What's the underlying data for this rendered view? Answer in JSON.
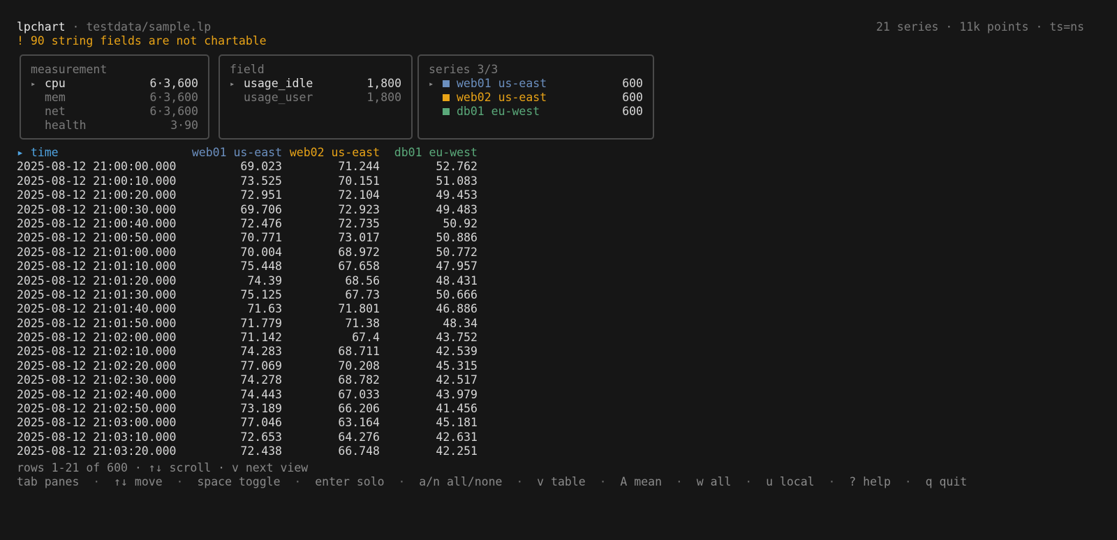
{
  "app": {
    "name": "lpchart",
    "separator": "·",
    "file": "testdata/sample.lp",
    "summary": "21 series · 11k points · ts=ns"
  },
  "warning": "! 90 string fields are not chartable",
  "colors": {
    "web01": "#6b8fbf",
    "web02": "#e8a317",
    "db01": "#5aa97a",
    "time_header": "#4fa3e0"
  },
  "panes": {
    "measurement": {
      "title": "measurement",
      "items": [
        {
          "label": "cpu",
          "count": "6·3,600",
          "active": true
        },
        {
          "label": "mem",
          "count": "6·3,600",
          "active": false
        },
        {
          "label": "net",
          "count": "6·3,600",
          "active": false
        },
        {
          "label": "health",
          "count": "3·90",
          "active": false
        }
      ]
    },
    "field": {
      "title": "field",
      "items": [
        {
          "label": "usage_idle",
          "count": "1,800",
          "active": true
        },
        {
          "label": "usage_user",
          "count": "1,800",
          "active": false
        }
      ]
    },
    "series": {
      "title": "series 3/3",
      "items": [
        {
          "label": "web01 us-east",
          "count": "600",
          "color": "#6b8fbf",
          "icon": "square-swatch"
        },
        {
          "label": "web02 us-east",
          "count": "600",
          "color": "#e8a317",
          "icon": "square-swatch"
        },
        {
          "label": "db01 eu-west",
          "count": "600",
          "color": "#5aa97a",
          "icon": "square-swatch"
        }
      ]
    }
  },
  "table": {
    "header": {
      "marker": "▸",
      "time": "time",
      "cols": [
        {
          "label": "web01 us-east",
          "color": "#6b8fbf"
        },
        {
          "label": "web02 us-east",
          "color": "#e8a317"
        },
        {
          "label": "db01 eu-west",
          "color": "#5aa97a"
        }
      ]
    },
    "rows": [
      [
        "2025-08-12 21:00:00.000",
        "69.023",
        "71.244",
        "52.762"
      ],
      [
        "2025-08-12 21:00:10.000",
        "73.525",
        "70.151",
        "51.083"
      ],
      [
        "2025-08-12 21:00:20.000",
        "72.951",
        "72.104",
        "49.453"
      ],
      [
        "2025-08-12 21:00:30.000",
        "69.706",
        "72.923",
        "49.483"
      ],
      [
        "2025-08-12 21:00:40.000",
        "72.476",
        "72.735",
        "50.92"
      ],
      [
        "2025-08-12 21:00:50.000",
        "70.771",
        "73.017",
        "50.886"
      ],
      [
        "2025-08-12 21:01:00.000",
        "70.004",
        "68.972",
        "50.772"
      ],
      [
        "2025-08-12 21:01:10.000",
        "75.448",
        "67.658",
        "47.957"
      ],
      [
        "2025-08-12 21:01:20.000",
        "74.39",
        "68.56",
        "48.431"
      ],
      [
        "2025-08-12 21:01:30.000",
        "75.125",
        "67.73",
        "50.666"
      ],
      [
        "2025-08-12 21:01:40.000",
        "71.63",
        "71.801",
        "46.886"
      ],
      [
        "2025-08-12 21:01:50.000",
        "71.779",
        "71.38",
        "48.34"
      ],
      [
        "2025-08-12 21:02:00.000",
        "71.142",
        "67.4",
        "43.752"
      ],
      [
        "2025-08-12 21:02:10.000",
        "74.283",
        "68.711",
        "42.539"
      ],
      [
        "2025-08-12 21:02:20.000",
        "77.069",
        "70.208",
        "45.315"
      ],
      [
        "2025-08-12 21:02:30.000",
        "74.278",
        "68.782",
        "42.517"
      ],
      [
        "2025-08-12 21:02:40.000",
        "74.443",
        "67.033",
        "43.979"
      ],
      [
        "2025-08-12 21:02:50.000",
        "73.189",
        "66.206",
        "41.456"
      ],
      [
        "2025-08-12 21:03:00.000",
        "77.046",
        "63.164",
        "45.181"
      ],
      [
        "2025-08-12 21:03:10.000",
        "72.653",
        "64.276",
        "42.631"
      ],
      [
        "2025-08-12 21:03:20.000",
        "72.438",
        "66.748",
        "42.251"
      ]
    ]
  },
  "status": "rows 1-21 of 600 · ↑↓ scroll · v next view",
  "keybindings": [
    "tab panes",
    "↑↓ move",
    "space toggle",
    "enter solo",
    "a/n all/none",
    "v table",
    "A mean",
    "w all",
    "u local",
    "? help",
    "q quit"
  ],
  "keybinding_separator": "·"
}
